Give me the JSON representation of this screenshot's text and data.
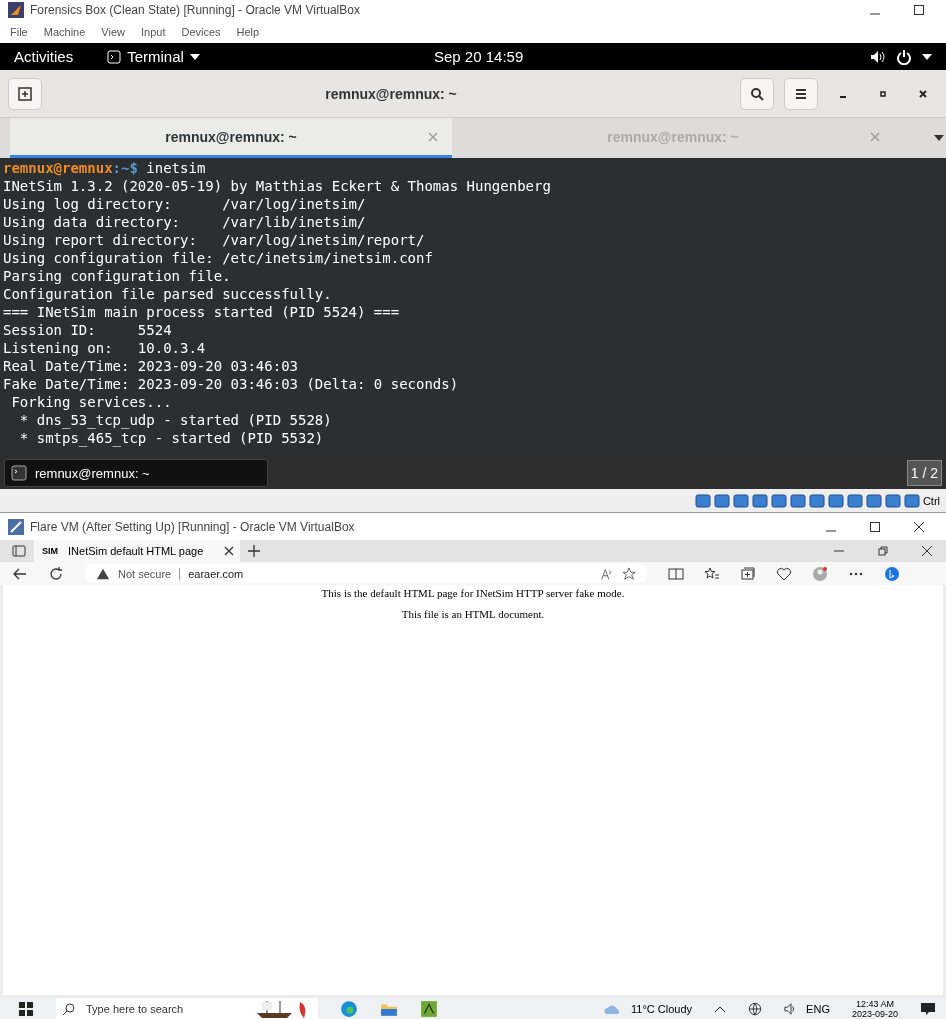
{
  "vm1": {
    "title": "Forensics Box (Clean State) [Running] - Oracle VM VirtualBox",
    "menu": [
      "File",
      "Machine",
      "View",
      "Input",
      "Devices",
      "Help"
    ],
    "topbar": {
      "activities": "Activities",
      "app": "Terminal",
      "clock": "Sep 20  14:59"
    },
    "header_title": "remnux@remnux: ~",
    "tabs": [
      {
        "label": "remnux@remnux: ~",
        "selected": true
      },
      {
        "label": "remnux@remnux: ~",
        "selected": false
      }
    ],
    "terminal": [
      {
        "kind": "prompt",
        "user": "remnux@remnux",
        "path": ":~$",
        "text": " inetsim"
      },
      {
        "kind": "output",
        "text": "INetSim 1.3.2 (2020-05-19) by Matthias Eckert & Thomas Hungenberg"
      },
      {
        "kind": "output",
        "text": "Using log directory:      /var/log/inetsim/"
      },
      {
        "kind": "output",
        "text": "Using data directory:     /var/lib/inetsim/"
      },
      {
        "kind": "output",
        "text": "Using report directory:   /var/log/inetsim/report/"
      },
      {
        "kind": "output",
        "text": "Using configuration file: /etc/inetsim/inetsim.conf"
      },
      {
        "kind": "output",
        "text": "Parsing configuration file."
      },
      {
        "kind": "output",
        "text": "Configuration file parsed successfully."
      },
      {
        "kind": "output",
        "text": "=== INetSim main process started (PID 5524) ==="
      },
      {
        "kind": "output",
        "text": "Session ID:     5524"
      },
      {
        "kind": "output",
        "text": "Listening on:   10.0.3.4"
      },
      {
        "kind": "output",
        "text": "Real Date/Time: 2023-09-20 03:46:03"
      },
      {
        "kind": "output",
        "text": "Fake Date/Time: 2023-09-20 03:46:03 (Delta: 0 seconds)"
      },
      {
        "kind": "output",
        "text": " Forking services..."
      },
      {
        "kind": "output",
        "text": "  * dns_53_tcp_udp - started (PID 5528)"
      },
      {
        "kind": "output",
        "text": "  * smtps_465_tcp - started (PID 5532)"
      }
    ],
    "taskbar_item": "remnux@remnux: ~",
    "workspace": "1 / 2",
    "host_key": "Ctrl"
  },
  "vm2": {
    "title": "Flare VM (After Setting Up) [Running] - Oracle VM VirtualBox",
    "browser_tab": {
      "favicon": "SIM",
      "label": "INetSim default HTML page"
    },
    "address": {
      "security": "Not secure",
      "url": "earaer.com"
    },
    "page_lines": [
      "This is the default HTML page for INetSim HTTP server fake mode.",
      "This file is an HTML document."
    ],
    "taskbar": {
      "search_placeholder": "Type here to search",
      "weather": "11°C  Cloudy",
      "lang": "ENG",
      "time": "12:43 AM",
      "date": "2023-09-20"
    }
  }
}
